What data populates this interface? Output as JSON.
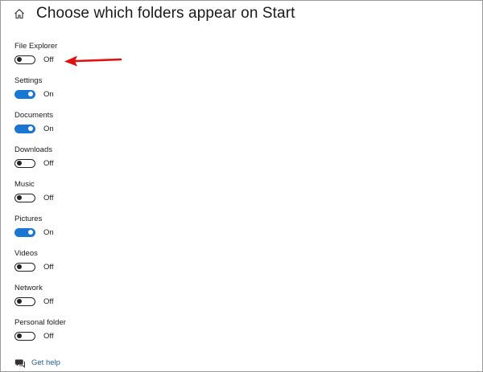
{
  "header": {
    "title": "Choose which folders appear on Start",
    "home_icon": "home-icon"
  },
  "settings": [
    {
      "label": "File Explorer",
      "state": "Off",
      "on": false
    },
    {
      "label": "Settings",
      "state": "On",
      "on": true
    },
    {
      "label": "Documents",
      "state": "On",
      "on": true
    },
    {
      "label": "Downloads",
      "state": "Off",
      "on": false
    },
    {
      "label": "Music",
      "state": "Off",
      "on": false
    },
    {
      "label": "Pictures",
      "state": "On",
      "on": true
    },
    {
      "label": "Videos",
      "state": "Off",
      "on": false
    },
    {
      "label": "Network",
      "state": "Off",
      "on": false
    },
    {
      "label": "Personal folder",
      "state": "Off",
      "on": false
    }
  ],
  "footer": {
    "help_label": "Get help",
    "help_icon": "chat-help-icon"
  },
  "colors": {
    "accent": "#1976d2",
    "annotation_arrow": "#e01010",
    "link": "#1f5fa8"
  }
}
